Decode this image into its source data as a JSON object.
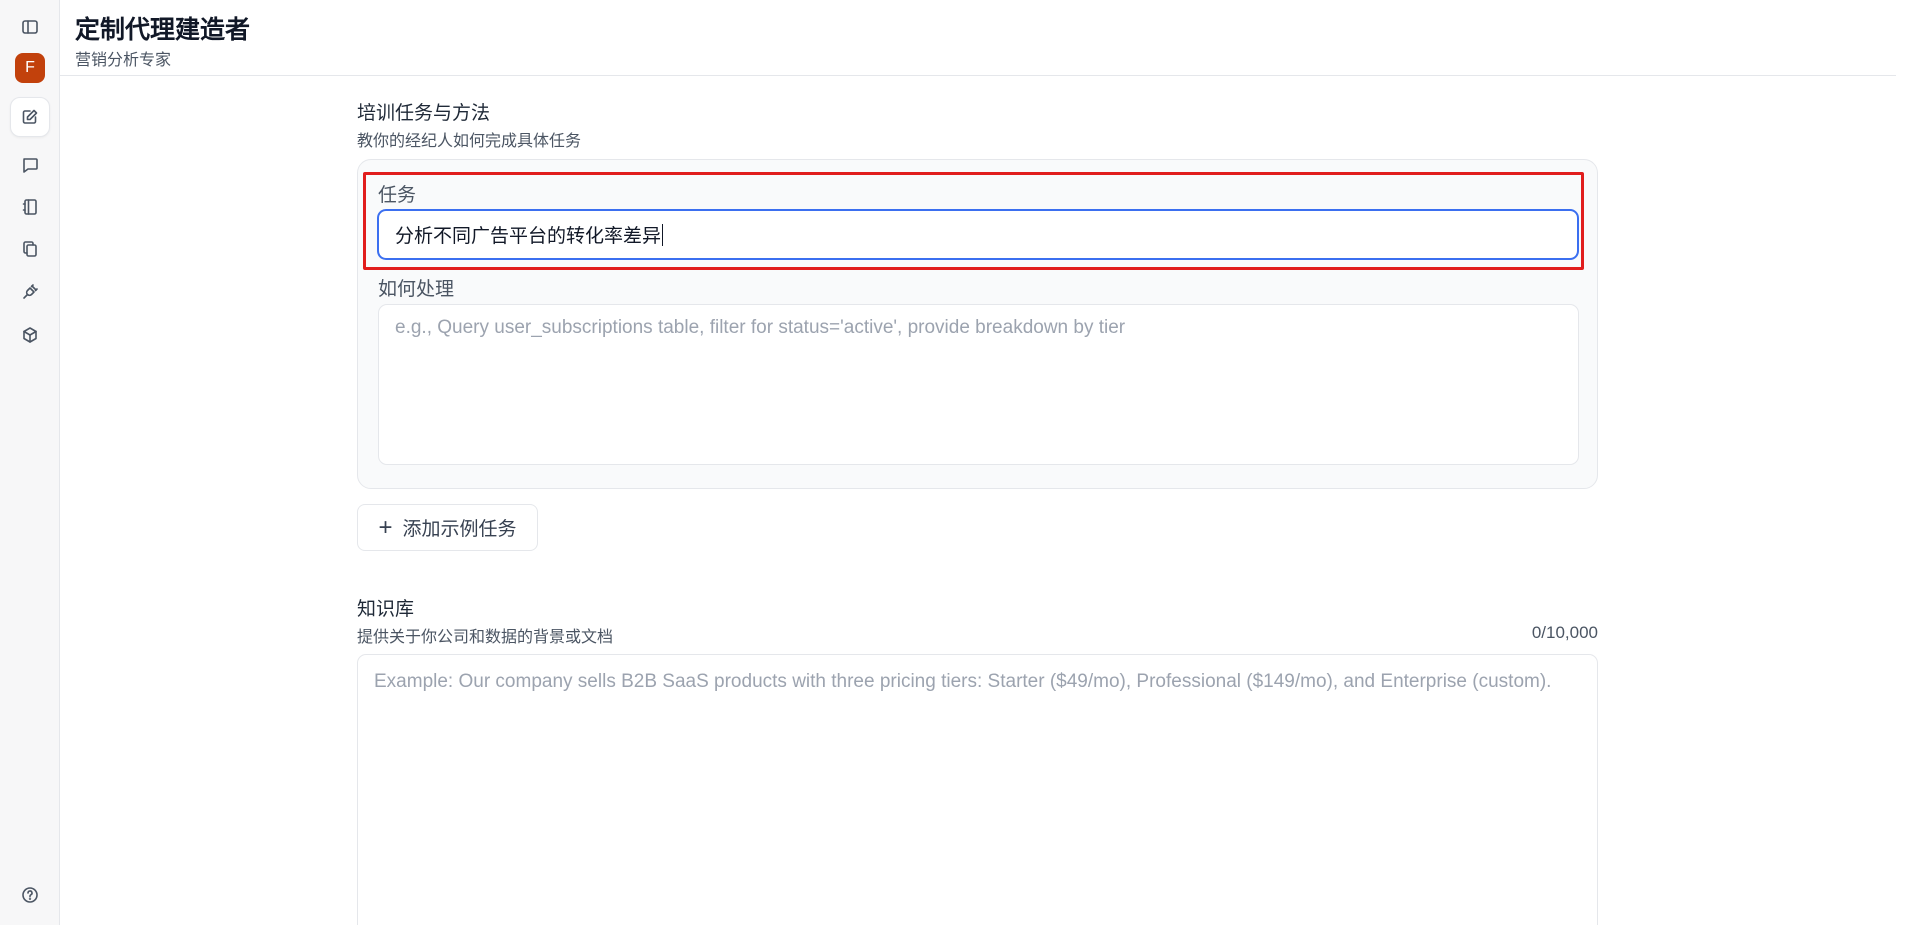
{
  "sidebar": {
    "avatar_letter": "F",
    "icons": [
      "sidebar-toggle-icon",
      "edit-icon",
      "chat-icon",
      "notebook-icon",
      "copy-icon",
      "plug-icon",
      "cube-icon",
      "help-icon"
    ]
  },
  "header": {
    "title": "定制代理建造者",
    "subtitle": "营销分析专家"
  },
  "training": {
    "title": "培训任务与方法",
    "description": "教你的经纪人如何完成具体任务",
    "task_label": "任务",
    "task_value": "分析不同广告平台的转化率差异",
    "howto_label": "如何处理",
    "howto_placeholder": "e.g., Query user_subscriptions table, filter for status='active', provide breakdown by tier",
    "add_button": "添加示例任务"
  },
  "knowledge": {
    "title": "知识库",
    "description": "提供关于你公司和数据的背景或文档",
    "counter": "0/10,000",
    "placeholder": "Example: Our company sells B2B SaaS products with three pricing tiers: Starter ($49/mo), Professional ($149/mo), and Enterprise (custom)."
  },
  "colors": {
    "accent": "#3b6ff0",
    "highlight": "#e11d1d",
    "avatar": "#c2410c"
  }
}
